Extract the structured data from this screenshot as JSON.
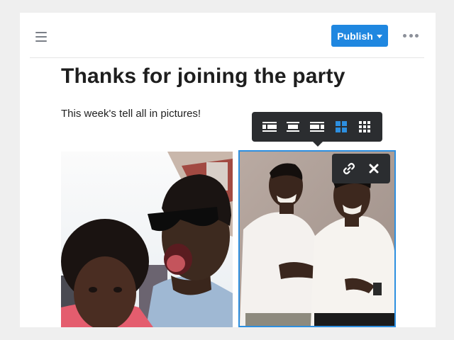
{
  "header": {
    "menu_icon": "hamburger-icon",
    "publish_label": "Publish",
    "more_icon": "more-horizontal-icon"
  },
  "post": {
    "title": "Thanks for joining the party",
    "subtitle": "This week's tell all in pictures!"
  },
  "image_toolbar": {
    "buttons": [
      {
        "icon": "align-left-wrap-icon",
        "active": false
      },
      {
        "icon": "align-center-icon",
        "active": false
      },
      {
        "icon": "align-right-wrap-icon",
        "active": false
      },
      {
        "icon": "grid-2x2-icon",
        "active": true
      },
      {
        "icon": "grid-3x3-icon",
        "active": false
      }
    ]
  },
  "image_actions": {
    "buttons": [
      {
        "icon": "link-icon"
      },
      {
        "icon": "close-icon"
      }
    ]
  },
  "colors": {
    "accent": "#1f87e0",
    "selection": "#2d8fe0",
    "toolbar_bg": "#2b2d30",
    "active_icon": "#2d8fe0"
  }
}
